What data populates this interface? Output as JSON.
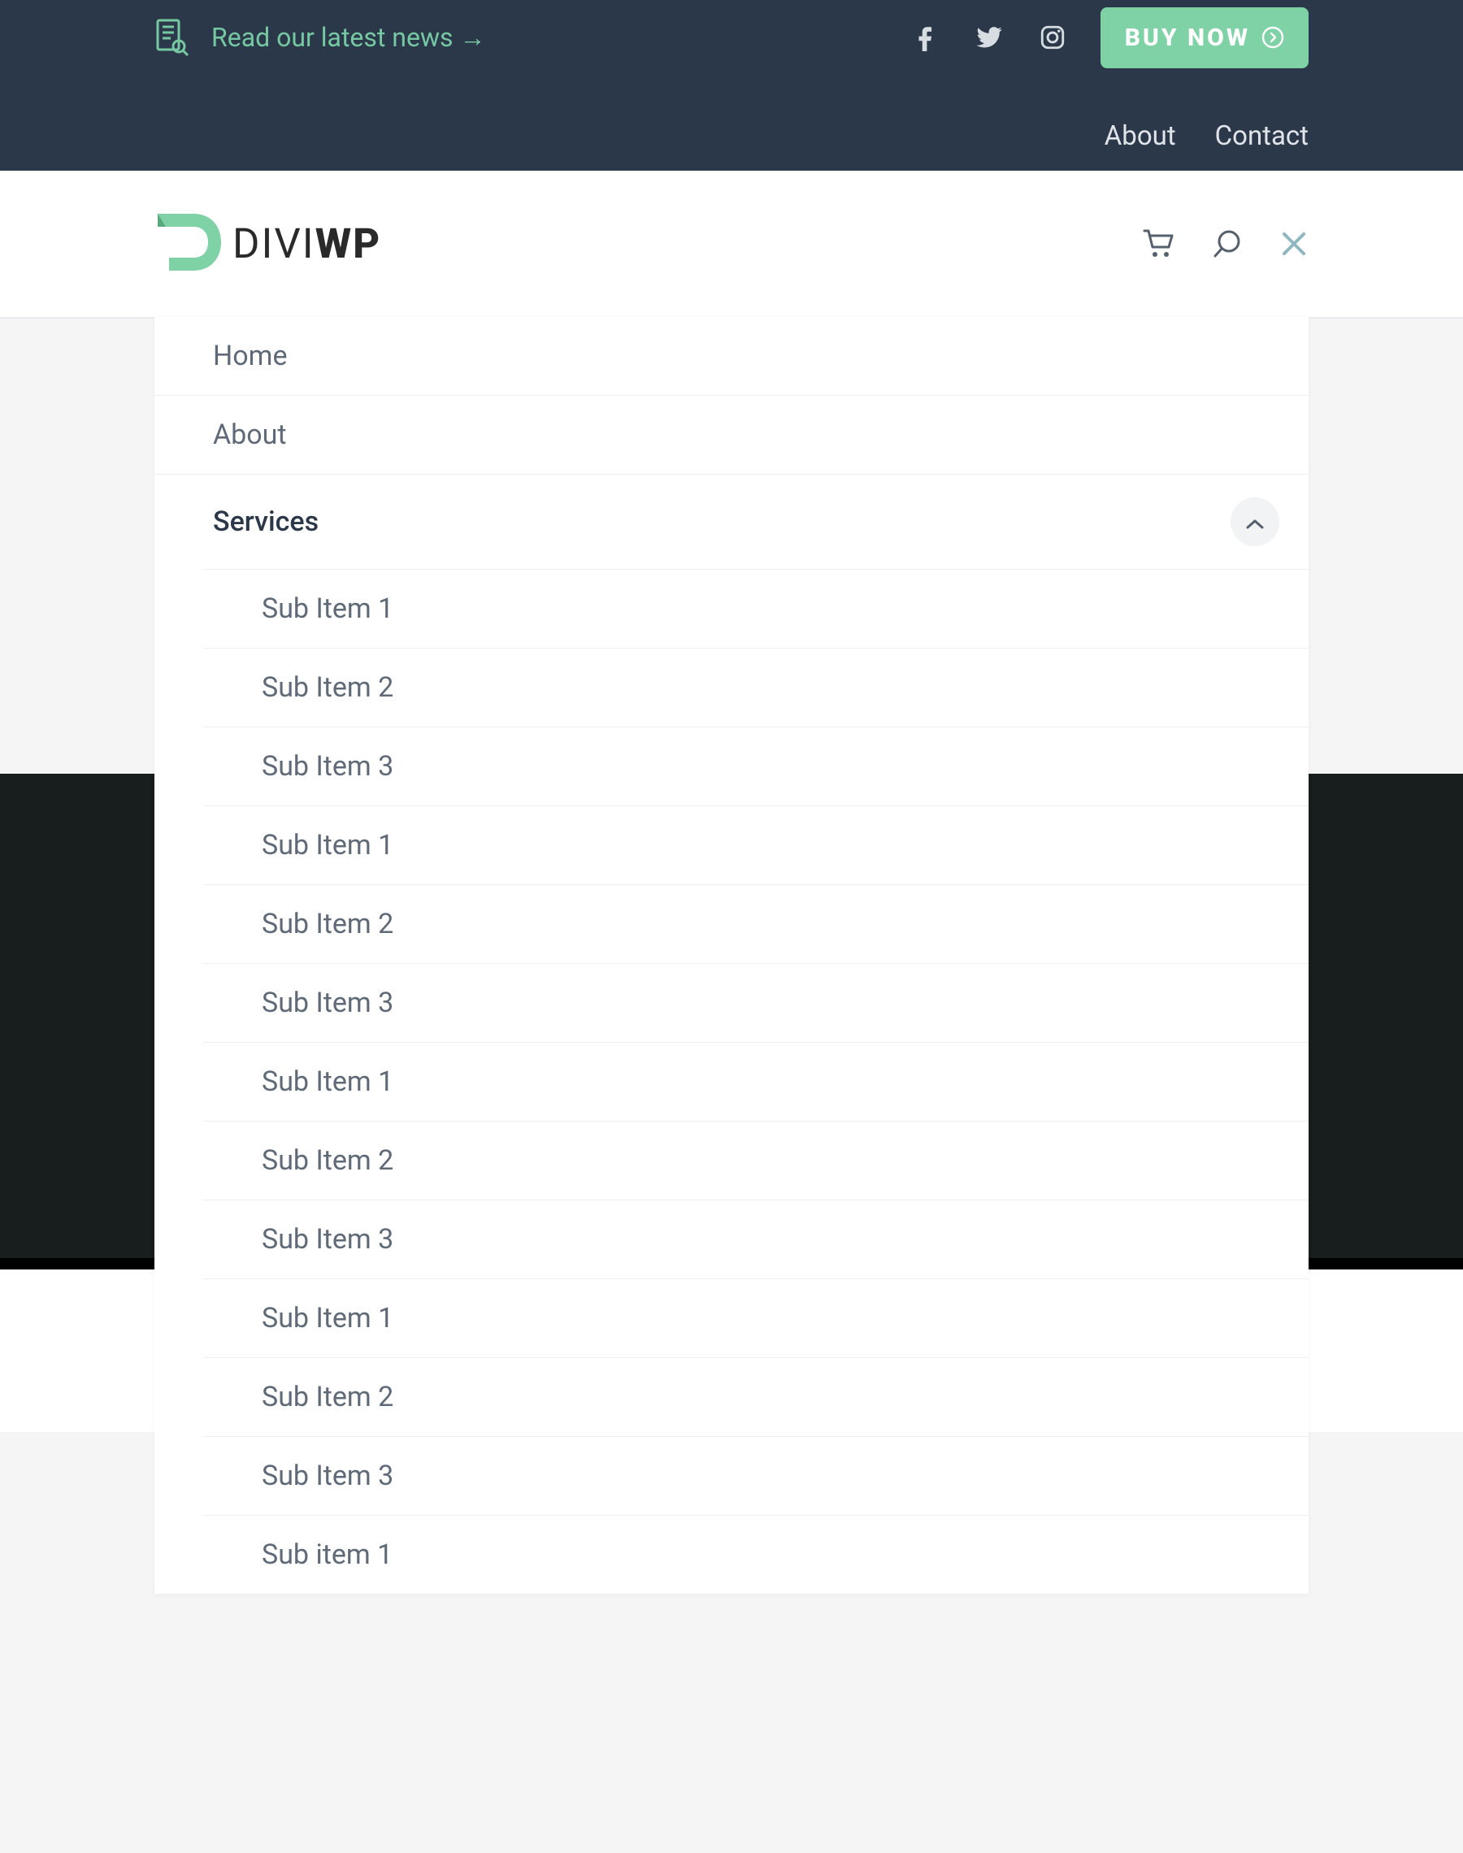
{
  "topbar": {
    "news_label": "Read our latest news →",
    "buy_label": "BUY NOW",
    "links": {
      "about": "About",
      "contact": "Contact"
    }
  },
  "logo": {
    "part1": "DIVI",
    "part2": "WP"
  },
  "menu": {
    "items": [
      {
        "label": "Home"
      },
      {
        "label": "About"
      },
      {
        "label": "Services",
        "active": true
      }
    ],
    "sub_items": [
      {
        "label": "Sub Item 1"
      },
      {
        "label": "Sub Item 2"
      },
      {
        "label": "Sub Item 3"
      },
      {
        "label": "Sub Item 1"
      },
      {
        "label": "Sub Item 2"
      },
      {
        "label": "Sub Item 3"
      },
      {
        "label": "Sub Item 1"
      },
      {
        "label": "Sub Item 2"
      },
      {
        "label": "Sub Item 3"
      },
      {
        "label": "Sub Item 1"
      },
      {
        "label": "Sub Item 2"
      },
      {
        "label": "Sub Item 3"
      },
      {
        "label": "Sub item 1"
      }
    ]
  },
  "colors": {
    "accent": "#7ed2a5",
    "dark": "#2a384a",
    "text_muted": "#5f6a78"
  }
}
